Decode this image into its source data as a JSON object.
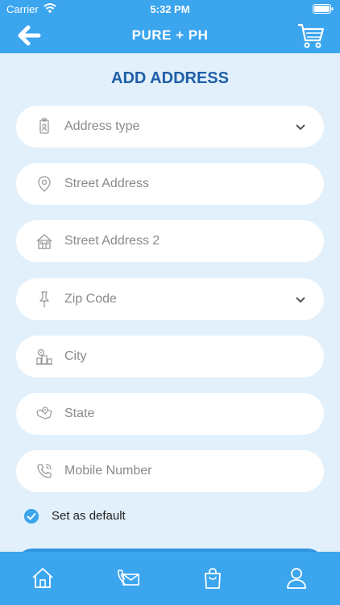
{
  "status": {
    "carrier": "Carrier",
    "time": "5:32 PM"
  },
  "header": {
    "title": "PURE + PH"
  },
  "page": {
    "title": "ADD ADDRESS"
  },
  "fields": [
    {
      "placeholder": "Address type",
      "icon": "badge-icon",
      "dropdown": true
    },
    {
      "placeholder": "Street Address",
      "icon": "location-pin-icon",
      "dropdown": false
    },
    {
      "placeholder": "Street Address 2",
      "icon": "house-icon",
      "dropdown": false
    },
    {
      "placeholder": "Zip Code",
      "icon": "pushpin-icon",
      "dropdown": true
    },
    {
      "placeholder": "City",
      "icon": "city-icon",
      "dropdown": false
    },
    {
      "placeholder": "State",
      "icon": "map-icon",
      "dropdown": false
    },
    {
      "placeholder": "Mobile Number",
      "icon": "phone-icon",
      "dropdown": false
    }
  ],
  "default_option": {
    "label": "Set as default",
    "checked": true
  },
  "tabs": [
    {
      "icon": "home-icon"
    },
    {
      "icon": "contact-icon"
    },
    {
      "icon": "shopping-bag-icon"
    },
    {
      "icon": "profile-icon"
    }
  ],
  "colors": {
    "primary": "#3ba5ee",
    "title": "#1f5ea8",
    "background": "#e1f0fb"
  }
}
